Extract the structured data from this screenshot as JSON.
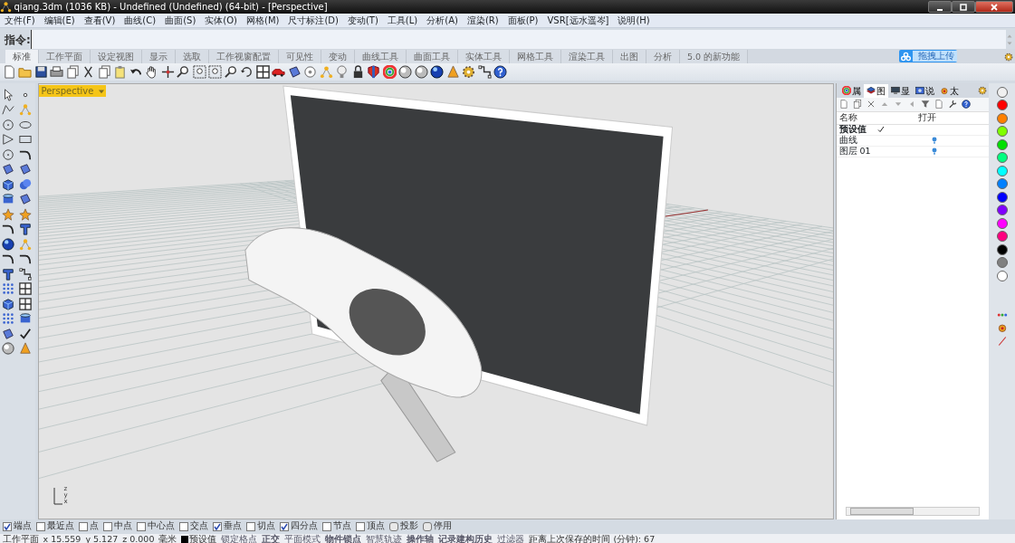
{
  "window": {
    "title": "qiang.3dm (1036 KB) - Undefined (Undefined) (64-bit) - [Perspective]"
  },
  "menu": [
    "文件(F)",
    "编辑(E)",
    "查看(V)",
    "曲线(C)",
    "曲面(S)",
    "实体(O)",
    "网格(M)",
    "尺寸标注(D)",
    "变动(T)",
    "工具(L)",
    "分析(A)",
    "渲染(R)",
    "面板(P)",
    "VSR[远水遥岑]",
    "说明(H)"
  ],
  "command": {
    "label": "指令:"
  },
  "upload_widget": {
    "label": "拖拽上传"
  },
  "toolbar_tabs": [
    {
      "label": "标准",
      "selected": true
    },
    {
      "label": "工作平面",
      "selected": false
    },
    {
      "label": "设定视图",
      "selected": false
    },
    {
      "label": "显示",
      "selected": false
    },
    {
      "label": "选取",
      "selected": false
    },
    {
      "label": "工作视窗配置",
      "selected": false
    },
    {
      "label": "可见性",
      "selected": false
    },
    {
      "label": "变动",
      "selected": false
    },
    {
      "label": "曲线工具",
      "selected": false
    },
    {
      "label": "曲面工具",
      "selected": false
    },
    {
      "label": "实体工具",
      "selected": false
    },
    {
      "label": "网格工具",
      "selected": false
    },
    {
      "label": "渲染工具",
      "selected": false
    },
    {
      "label": "出图",
      "selected": false
    },
    {
      "label": "分析",
      "selected": false
    },
    {
      "label": "5.0 的新功能",
      "selected": false
    }
  ],
  "viewport": {
    "title": "Perspective",
    "axis_labels": [
      "z",
      "y",
      "x"
    ]
  },
  "panel": {
    "tabs": [
      {
        "label": "属",
        "selected": false
      },
      {
        "label": "图",
        "selected": true
      },
      {
        "label": "显",
        "selected": false
      },
      {
        "label": "说",
        "selected": false
      },
      {
        "label": "太",
        "selected": false
      }
    ],
    "columns": [
      "名称",
      "打开"
    ],
    "layers": [
      {
        "name": "预设值",
        "current": true,
        "light": false
      },
      {
        "name": "曲线",
        "current": false,
        "light": true
      },
      {
        "name": "图层 01",
        "current": false,
        "light": true
      }
    ]
  },
  "color_swatches": [
    {
      "color": "#f0f0f0"
    },
    {
      "color": "#ff0000"
    },
    {
      "color": "#ff8000"
    },
    {
      "color": "#80ff00"
    },
    {
      "color": "#00e000"
    },
    {
      "color": "#00ff80"
    },
    {
      "color": "#00ffff"
    },
    {
      "color": "#0080ff"
    },
    {
      "color": "#0000ff"
    },
    {
      "color": "#8000ff"
    },
    {
      "color": "#ff00ff"
    },
    {
      "color": "#ff0080"
    },
    {
      "color": "#000000"
    },
    {
      "color": "#808080"
    },
    {
      "color": "#ffffff"
    }
  ],
  "osnaps": [
    {
      "label": "端点",
      "checked": true,
      "kind": "square"
    },
    {
      "label": "最近点",
      "checked": false,
      "kind": "square"
    },
    {
      "label": "点",
      "checked": false,
      "kind": "square"
    },
    {
      "label": "中点",
      "checked": false,
      "kind": "square"
    },
    {
      "label": "中心点",
      "checked": false,
      "kind": "square"
    },
    {
      "label": "交点",
      "checked": false,
      "kind": "square"
    },
    {
      "label": "垂点",
      "checked": true,
      "kind": "square"
    },
    {
      "label": "切点",
      "checked": false,
      "kind": "square"
    },
    {
      "label": "四分点",
      "checked": true,
      "kind": "square"
    },
    {
      "label": "节点",
      "checked": false,
      "kind": "square"
    },
    {
      "label": "顶点",
      "checked": false,
      "kind": "square"
    },
    {
      "label": "投影",
      "checked": false,
      "kind": "round"
    },
    {
      "label": "停用",
      "checked": false,
      "kind": "round"
    }
  ],
  "status": [
    {
      "text": "工作平面",
      "on": false,
      "kind": "plain"
    },
    {
      "text": "x 15.559",
      "on": false,
      "kind": "plain"
    },
    {
      "text": "y 5.127",
      "on": false,
      "kind": "plain"
    },
    {
      "text": "z 0.000",
      "on": false,
      "kind": "plain"
    },
    {
      "text": "毫米",
      "on": false,
      "kind": "plain"
    },
    {
      "text": "预设值",
      "on": false,
      "kind": "layer",
      "color": "#000000"
    },
    {
      "text": "锁定格点",
      "on": false,
      "kind": "pane"
    },
    {
      "text": "正交",
      "on": true,
      "kind": "pane"
    },
    {
      "text": "平面模式",
      "on": false,
      "kind": "pane"
    },
    {
      "text": "物件锁点",
      "on": true,
      "kind": "pane"
    },
    {
      "text": "智慧轨迹",
      "on": false,
      "kind": "pane"
    },
    {
      "text": "操作轴",
      "on": true,
      "kind": "pane"
    },
    {
      "text": "记录建构历史",
      "on": true,
      "kind": "pane"
    },
    {
      "text": "过滤器",
      "on": false,
      "kind": "pane"
    },
    {
      "text": "距离上次保存的时间 (分钟): 67",
      "on": false,
      "kind": "plain"
    }
  ]
}
